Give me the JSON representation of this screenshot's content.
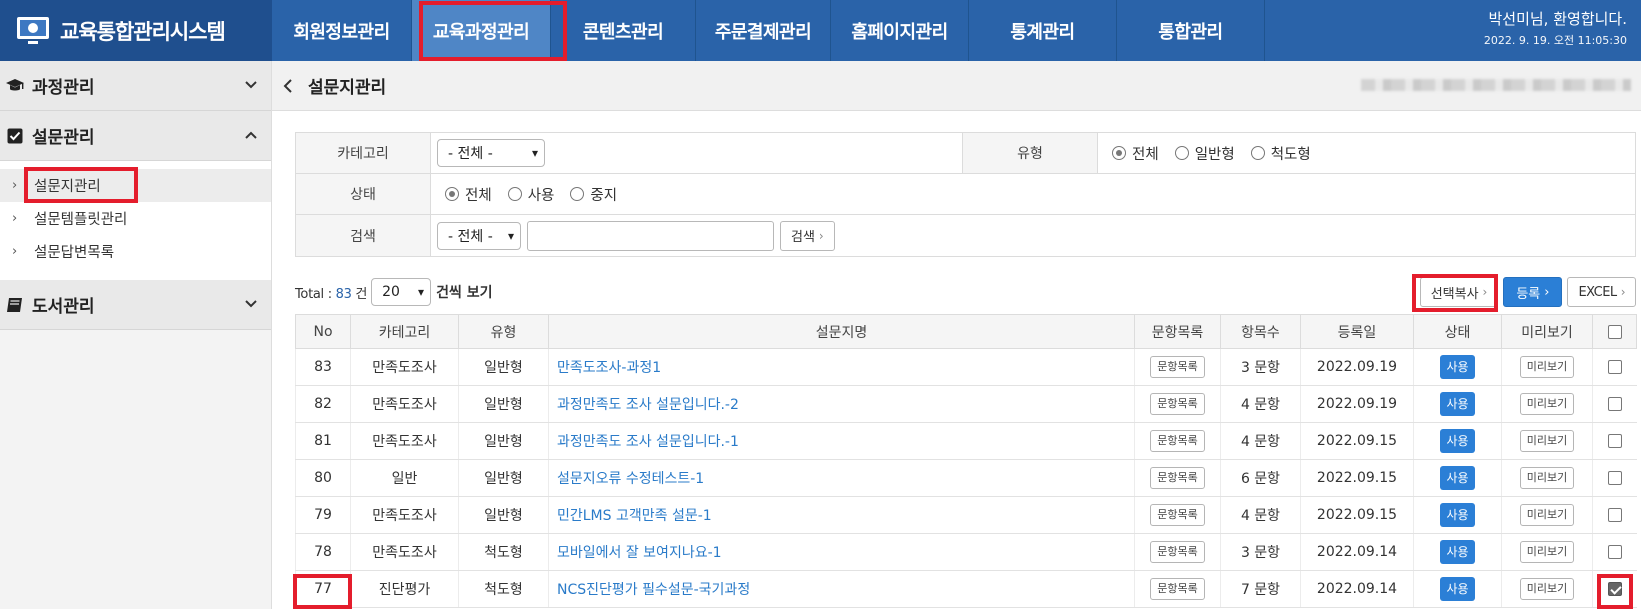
{
  "header": {
    "brand": "교육통합관리시스템",
    "nav": [
      "회원정보관리",
      "교육과정관리",
      "콘텐츠관리",
      "주문결제관리",
      "홈페이지관리",
      "통계관리",
      "통합관리"
    ],
    "greeting": "박선미님, 환영합니다.",
    "datetime": "2022. 9. 19. 오전 11:05:30"
  },
  "sidebar": {
    "sections": [
      {
        "label": "과정관리",
        "icon": "graduation-cap-icon"
      },
      {
        "label": "설문관리",
        "icon": "checkbox-icon"
      },
      {
        "label": "도서관리",
        "icon": "book-icon"
      }
    ],
    "survey_items": [
      "설문지관리",
      "설문템플릿관리",
      "설문답변목록"
    ]
  },
  "page": {
    "title": "설문지관리"
  },
  "search": {
    "category_label": "카테고리",
    "category_value": "- 전체 -",
    "type_label": "유형",
    "type_options": [
      "전체",
      "일반형",
      "척도형"
    ],
    "status_label": "상태",
    "status_options": [
      "전체",
      "사용",
      "중지"
    ],
    "keyword_label": "검색",
    "keyword_select": "- 전체 -",
    "keyword_value": "",
    "search_button": "검색"
  },
  "toolbar": {
    "total_prefix": "Total : ",
    "total_count": "83",
    "total_suffix": " 건",
    "page_size": "20",
    "page_size_suffix": "건씩 보기",
    "copy_button": "선택복사",
    "register_button": "등록",
    "excel_button": "EXCEL"
  },
  "table": {
    "headers": [
      "No",
      "카테고리",
      "유형",
      "설문지명",
      "문항목록",
      "항목수",
      "등록일",
      "상태",
      "미리보기",
      ""
    ],
    "item_list_label": "문항목록",
    "preview_label": "미리보기",
    "rows": [
      {
        "no": "83",
        "category": "만족도조사",
        "type": "일반형",
        "title": "만족도조사-과정1",
        "count": "3 문항",
        "date": "2022.09.19",
        "status": "사용",
        "checked": false
      },
      {
        "no": "82",
        "category": "만족도조사",
        "type": "일반형",
        "title": "과정만족도 조사 설문입니다.-2",
        "count": "4 문항",
        "date": "2022.09.19",
        "status": "사용",
        "checked": false
      },
      {
        "no": "81",
        "category": "만족도조사",
        "type": "일반형",
        "title": "과정만족도 조사 설문입니다.-1",
        "count": "4 문항",
        "date": "2022.09.15",
        "status": "사용",
        "checked": false
      },
      {
        "no": "80",
        "category": "일반",
        "type": "일반형",
        "title": "설문지오류 수정테스트-1",
        "count": "6 문항",
        "date": "2022.09.15",
        "status": "사용",
        "checked": false
      },
      {
        "no": "79",
        "category": "만족도조사",
        "type": "일반형",
        "title": "민간LMS 고객만족 설문-1",
        "count": "4 문항",
        "date": "2022.09.15",
        "status": "사용",
        "checked": false
      },
      {
        "no": "78",
        "category": "만족도조사",
        "type": "척도형",
        "title": "모바일에서 잘 보여지나요-1",
        "count": "3 문항",
        "date": "2022.09.14",
        "status": "사용",
        "checked": false
      },
      {
        "no": "77",
        "category": "진단평가",
        "type": "척도형",
        "title": "NCS진단평가 필수설문-국기과정",
        "count": "7 문항",
        "date": "2022.09.14",
        "status": "사용",
        "checked": true
      }
    ]
  },
  "colors": {
    "nav": "#2a63a9",
    "brand": "#1f4f8e",
    "accent": "#2b7fd6",
    "highlight": "#e41d2c"
  }
}
